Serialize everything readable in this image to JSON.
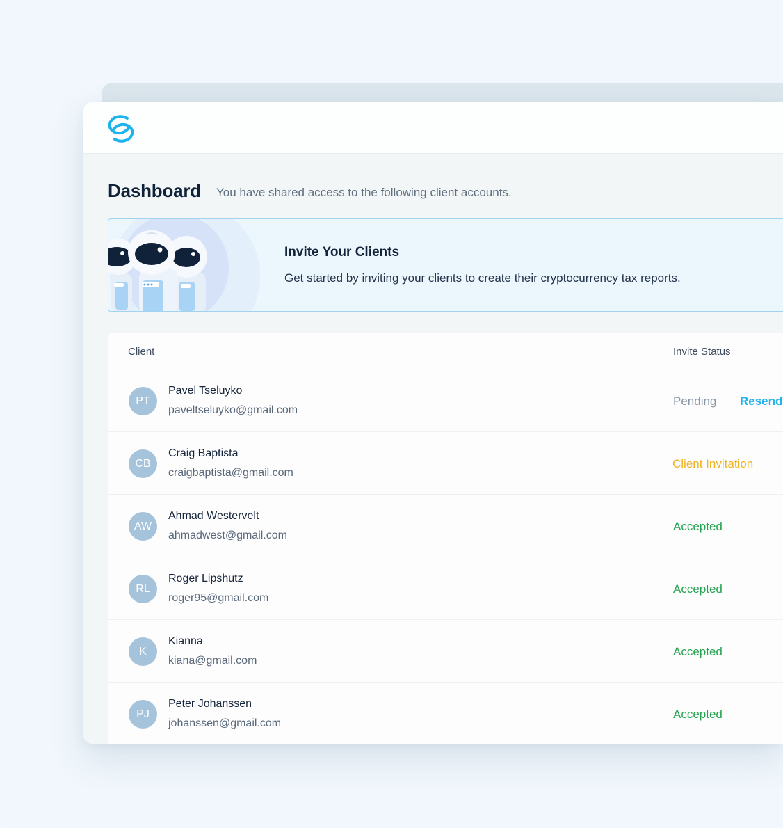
{
  "header": {
    "title": "Dashboard",
    "subtitle": "You have shared access to the following client accounts."
  },
  "banner": {
    "title": "Invite Your Clients",
    "text": "Get started by inviting your clients to create their cryptocurrency tax reports."
  },
  "table": {
    "columns": {
      "client": "Client",
      "status": "Invite Status"
    },
    "rows": [
      {
        "initials": "PT",
        "name": "Pavel Tseluyko",
        "email": "paveltseluyko@gmail.com",
        "status": "Pending",
        "action": "Resend"
      },
      {
        "initials": "CB",
        "name": "Craig Baptista",
        "email": "craigbaptista@gmail.com",
        "status": "Client Invitation"
      },
      {
        "initials": "AW",
        "name": "Ahmad Westervelt",
        "email": "ahmadwest@gmail.com",
        "status": "Accepted"
      },
      {
        "initials": "RL",
        "name": "Roger Lipshutz",
        "email": "roger95@gmail.com",
        "status": "Accepted"
      },
      {
        "initials": "K",
        "name": "Kianna",
        "email": "kiana@gmail.com",
        "status": "Accepted"
      },
      {
        "initials": "PJ",
        "name": "Peter Johanssen",
        "email": "johanssen@gmail.com",
        "status": "Accepted"
      }
    ]
  },
  "colors": {
    "brand": "#1fb3ee",
    "pending": "#8896a4",
    "invitation": "#efb321",
    "accepted": "#26a350",
    "avatar": "#a6c3dc"
  },
  "icons": {
    "logo": "brand-logo-icon",
    "illustration": "robots-illustration"
  }
}
